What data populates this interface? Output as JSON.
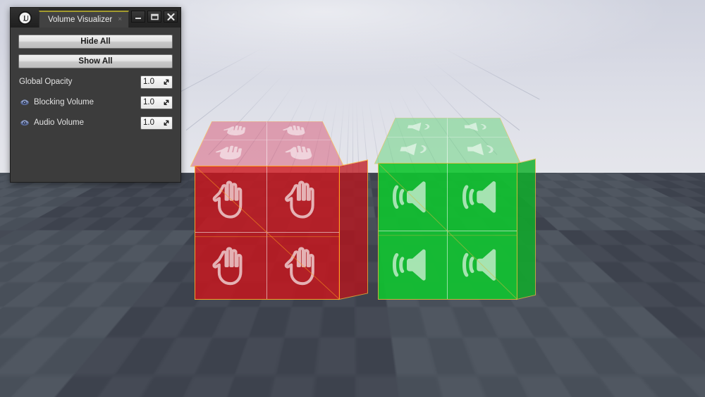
{
  "window": {
    "app_logo": "unreal-engine-logo",
    "tab_label": "Volume Visualizer",
    "tab_close_glyph": "×",
    "controls": [
      {
        "name": "minimize-button",
        "glyph": "minimize-icon"
      },
      {
        "name": "maximize-button",
        "glyph": "maximize-icon"
      },
      {
        "name": "close-button",
        "glyph": "close-icon"
      }
    ]
  },
  "panel": {
    "buttons": [
      {
        "label": "Hide All",
        "name": "hide-all-button"
      },
      {
        "label": "Show All",
        "name": "show-all-button"
      }
    ],
    "properties": [
      {
        "label": "Global Opacity",
        "value": "1.0",
        "has_icon": false,
        "icon": ""
      },
      {
        "label": "Blocking Volume",
        "value": "1.0",
        "has_icon": true,
        "icon": "visibility-eye-icon"
      },
      {
        "label": "Audio Volume",
        "value": "1.0",
        "has_icon": true,
        "icon": "visibility-eye-icon"
      }
    ]
  },
  "viewport": {
    "name": "level-viewport",
    "sky_color": "#dcdee7",
    "floor_color": "#474d58",
    "wireframe_color": "#ffa81e",
    "volumes": [
      {
        "name": "blocking-volume-cube",
        "kind": "Blocking Volume",
        "color": "#cd141c",
        "icon": "stop-hand-icon",
        "cells": 4
      },
      {
        "name": "audio-volume-cube",
        "kind": "Audio Volume",
        "color": "#10c430",
        "icon": "speaker-icon",
        "cells": 4
      }
    ]
  }
}
